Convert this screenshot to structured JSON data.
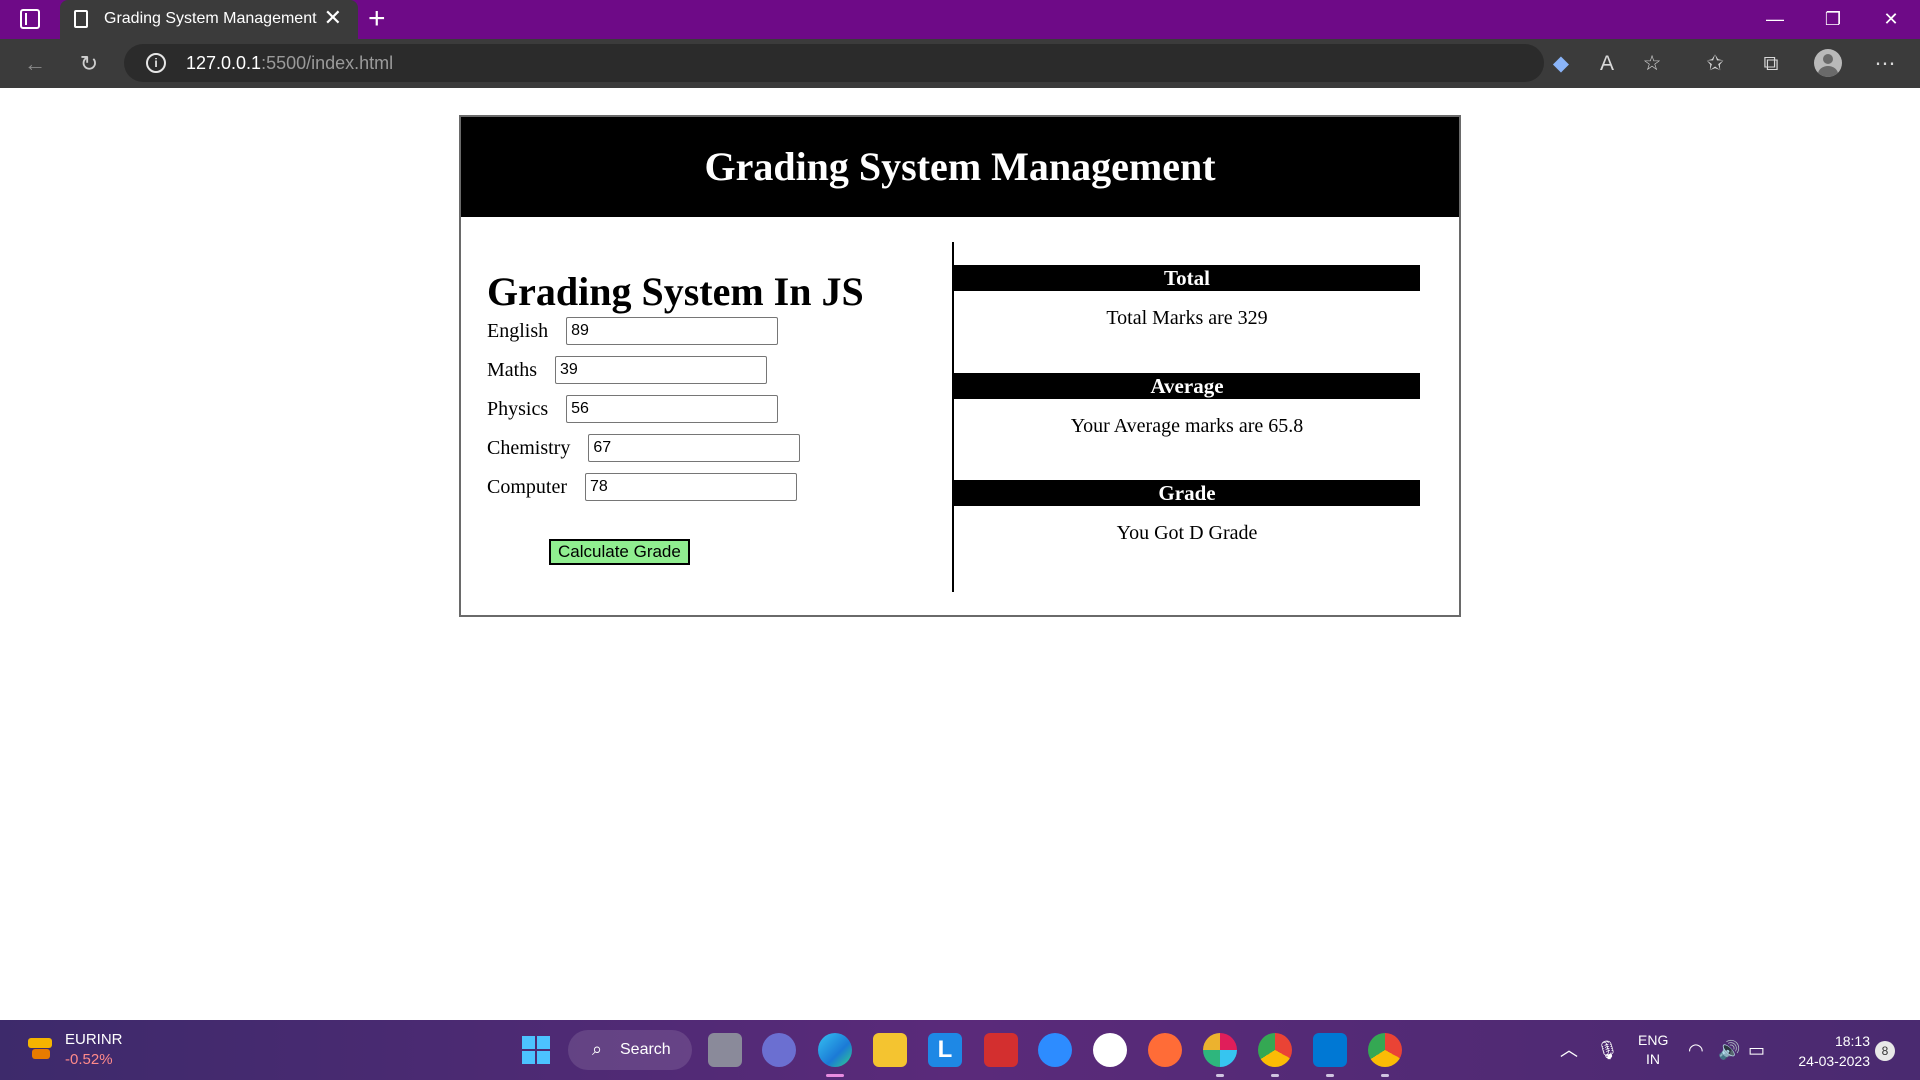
{
  "browser": {
    "tab_title": "Grading System Management",
    "url_host": "127.0.0.1",
    "url_rest": ":5500/index.html",
    "icons": [
      "sidebar-toggle-icon",
      "page-icon",
      "close-icon",
      "plus-icon",
      "back-icon",
      "refresh-icon",
      "info-icon",
      "tag-icon",
      "read-aloud-icon",
      "add-favorite-icon",
      "favorites-icon",
      "collections-icon",
      "profile-icon",
      "more-icon"
    ]
  },
  "app": {
    "header_title": "Grading System Management",
    "left_title": "Grading System In JS",
    "fields": [
      {
        "label": "English",
        "value": "89"
      },
      {
        "label": "Maths",
        "value": "39"
      },
      {
        "label": "Physics",
        "value": "56"
      },
      {
        "label": "Chemistry",
        "value": "67"
      },
      {
        "label": "Computer",
        "value": "78"
      }
    ],
    "calculate_label": "Calculate Grade",
    "total_heading": "Total",
    "total_text": "Total Marks are 329",
    "average_heading": "Average",
    "average_text": "Your Average marks are 65.8",
    "grade_heading": "Grade",
    "grade_text": "You Got D Grade",
    "colors": {
      "header_bg": "#000000",
      "button_bg": "#90ee90"
    }
  },
  "taskbar": {
    "ticker_name": "EURINR",
    "ticker_change": "-0.52%",
    "search_label": "Search",
    "language": "ENG",
    "region": "IN",
    "time": "18:13",
    "date": "24-03-2023",
    "notification_count": "8",
    "apps": [
      "file-explorer-app-icon",
      "meet-app-icon",
      "edge-app-icon",
      "folder-app-icon",
      "l-app-icon",
      "mcafee-app-icon",
      "zoom-app-icon",
      "mongodb-app-icon",
      "postman-app-icon",
      "slack-app-icon",
      "chrome-app-icon",
      "vscode-app-icon",
      "chrome-canary-app-icon"
    ]
  }
}
